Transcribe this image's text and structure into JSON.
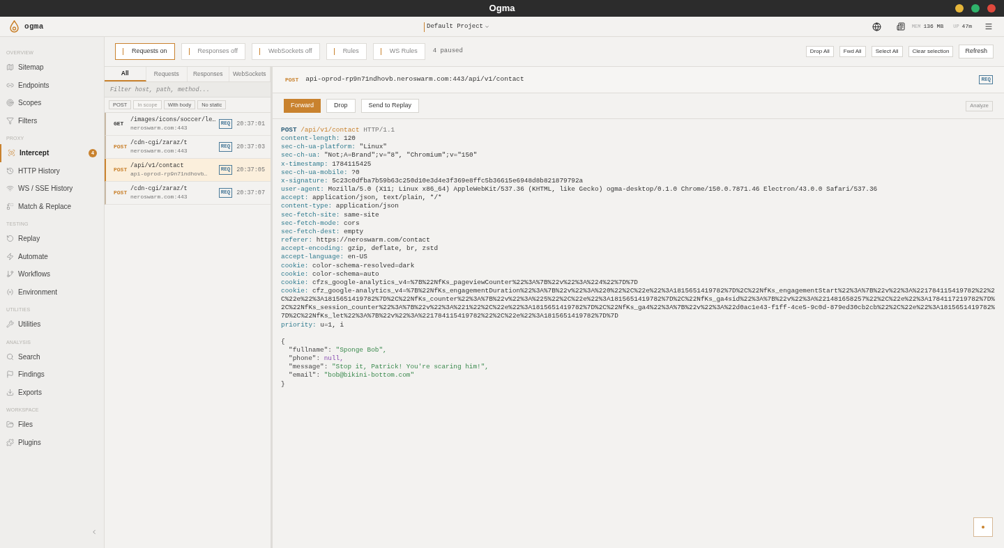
{
  "window": {
    "title": "Ogma"
  },
  "header": {
    "app_name": "ogma",
    "project": "Default Project",
    "mem_label": "MEM",
    "mem_value": "136 MB",
    "up_label": "UP",
    "up_value": "47m"
  },
  "sidebar": {
    "sections": [
      {
        "title": "OVERVIEW",
        "items": [
          {
            "label": "Sitemap",
            "selected": false
          },
          {
            "label": "Endpoints",
            "selected": false
          },
          {
            "label": "Scopes",
            "selected": false
          },
          {
            "label": "Filters",
            "selected": false
          }
        ]
      },
      {
        "title": "PROXY",
        "items": [
          {
            "label": "Intercept",
            "selected": true,
            "badge": "4"
          },
          {
            "label": "HTTP History",
            "selected": false
          },
          {
            "label": "WS / SSE History",
            "selected": false
          },
          {
            "label": "Match & Replace",
            "selected": false
          }
        ]
      },
      {
        "title": "TESTING",
        "items": [
          {
            "label": "Replay",
            "selected": false
          },
          {
            "label": "Automate",
            "selected": false
          },
          {
            "label": "Workflows",
            "selected": false
          },
          {
            "label": "Environment",
            "selected": false
          }
        ]
      },
      {
        "title": "UTILITIES",
        "items": [
          {
            "label": "Utilities",
            "selected": false
          }
        ]
      },
      {
        "title": "ANALYSIS",
        "items": [
          {
            "label": "Search",
            "selected": false
          },
          {
            "label": "Findings",
            "selected": false
          },
          {
            "label": "Exports",
            "selected": false
          }
        ]
      },
      {
        "title": "WORKSPACE",
        "items": [
          {
            "label": "Files",
            "selected": false
          },
          {
            "label": "Plugins",
            "selected": false
          }
        ]
      }
    ]
  },
  "toolbar": {
    "toggles": [
      {
        "label": "Requests on",
        "active": true
      },
      {
        "label": "Responses off",
        "active": false
      },
      {
        "label": "WebSockets off",
        "active": false
      },
      {
        "label": "Rules",
        "active": false
      },
      {
        "label": "WS Rules",
        "active": false
      }
    ],
    "paused": "4 paused",
    "actions": [
      "Drop All",
      "Fwd All",
      "Select All",
      "Clear selection"
    ],
    "refresh": "Refresh"
  },
  "flows": {
    "tabs": [
      {
        "label": "All",
        "selected": true
      },
      {
        "label": "Requests",
        "selected": false
      },
      {
        "label": "Responses",
        "selected": false
      },
      {
        "label": "WebSockets",
        "selected": false
      }
    ],
    "filter_placeholder": "Filter host, path, method...",
    "chips": [
      {
        "label": "POST",
        "disabled": false
      },
      {
        "label": "In scope",
        "disabled": true
      },
      {
        "label": "With body",
        "disabled": false
      },
      {
        "label": "No static",
        "disabled": false
      }
    ],
    "rows": [
      {
        "method": "GET",
        "color": "#333333",
        "path": "/images/icons/soccer/le…",
        "host": "neroswarm.com:443",
        "badge": "REQ",
        "time": "20:37:01",
        "selected": false
      },
      {
        "method": "POST",
        "color": "#c9822e",
        "path": "/cdn-cgi/zaraz/t",
        "host": "neroswarm.com:443",
        "badge": "REQ",
        "time": "20:37:03",
        "selected": false
      },
      {
        "method": "POST",
        "color": "#c9822e",
        "path": "/api/v1/contact",
        "host": "api-oprod-rp9n71ndhovb…",
        "badge": "REQ",
        "time": "20:37:05",
        "selected": true
      },
      {
        "method": "POST",
        "color": "#c9822e",
        "path": "/cdn-cgi/zaraz/t",
        "host": "neroswarm.com:443",
        "badge": "REQ",
        "time": "20:37:07",
        "selected": false
      }
    ]
  },
  "detail": {
    "method": "POST",
    "url": "api-oprod-rp9n71ndhovb.neroswarm.com:443/api/v1/contact",
    "badge": "REQ",
    "buttons": [
      {
        "label": "Forward",
        "kind": "primary"
      },
      {
        "label": "Drop",
        "kind": "plain"
      },
      {
        "label": "Send to Replay",
        "kind": "plain"
      }
    ],
    "analyze": "Analyze",
    "request_line": {
      "method": "POST",
      "path": "/api/v1/contact",
      "version": "HTTP/1.1"
    },
    "headers": [
      {
        "name": "content-length:",
        "value": "120"
      },
      {
        "name": "sec-ch-ua-platform:",
        "value": "\"Linux\""
      },
      {
        "name": "sec-ch-ua:",
        "value": "\"Not;A=Brand\";v=\"8\", \"Chromium\";v=\"150\""
      },
      {
        "name": "x-timestamp:",
        "value": "1784115425"
      },
      {
        "name": "sec-ch-ua-mobile:",
        "value": "?0"
      },
      {
        "name": "x-signature:",
        "value": "5c23c0dfba7b59b63c250d10e3d4e3f369e8ffc5b36615e6948d8b821879792a"
      },
      {
        "name": "user-agent:",
        "value": "Mozilla/5.0 (X11; Linux x86_64) AppleWebKit/537.36 (KHTML, like Gecko) ogma-desktop/0.1.0 Chrome/150.0.7871.46 Electron/43.0.0 Safari/537.36"
      },
      {
        "name": "accept:",
        "value": "application/json, text/plain, */*"
      },
      {
        "name": "content-type:",
        "value": "application/json"
      },
      {
        "name": "sec-fetch-site:",
        "value": "same-site"
      },
      {
        "name": "sec-fetch-mode:",
        "value": "cors"
      },
      {
        "name": "sec-fetch-dest:",
        "value": "empty"
      },
      {
        "name": "referer:",
        "value": "https://neroswarm.com/contact"
      },
      {
        "name": "accept-encoding:",
        "value": "gzip, deflate, br, zstd"
      },
      {
        "name": "accept-language:",
        "value": "en-US"
      },
      {
        "name": "cookie:",
        "value": "color-schema-resolved=dark"
      },
      {
        "name": "cookie:",
        "value": "color-schema=auto"
      },
      {
        "name": "cookie:",
        "value": "cfzs_google-analytics_v4=%7B%22NfKs_pageviewCounter%22%3A%7B%22v%22%3A%224%22%7D%7D"
      },
      {
        "name": "cookie:",
        "value": "cfz_google-analytics_v4=%7B%22NfKs_engagementDuration%22%3A%7B%22v%22%3A%220%22%2C%22e%22%3A1815651419782%7D%2C%22NfKs_engagementStart%22%3A%7B%22v%22%3A%221784115419782%22%2C%22e%22%3A1815651419782%7D%2C%22NfKs_counter%22%3A%7B%22v%22%3A%225%22%2C%22e%22%3A1815651419782%7D%2C%22NfKs_ga4sid%22%3A%7B%22v%22%3A%221481658257%22%2C%22e%22%3A1784117219782%7D%2C%22NfKs_session_counter%22%3A%7B%22v%22%3A%221%22%2C%22e%22%3A1815651419782%7D%2C%22NfKs_ga4%22%3A%7B%22v%22%3A%22d0ac1e43-f1ff-4ce5-9c0d-879ed30cb2cb%22%2C%22e%22%3A1815651419782%7D%2C%22NfKs_let%22%3A%7B%22v%22%3A%221784115419782%22%2C%22e%22%3A1815651419782%7D%7D"
      },
      {
        "name": "priority:",
        "value": "u=1, i"
      }
    ],
    "body": [
      {
        "kind": "brace",
        "text": "{"
      },
      {
        "kind": "string",
        "key": "\"fullname\":",
        "value": "\"Sponge Bob\","
      },
      {
        "kind": "null",
        "key": "\"phone\":",
        "value": "null,"
      },
      {
        "kind": "string",
        "key": "\"message\":",
        "value": "\"Stop it, Patrick! You're scaring him!\","
      },
      {
        "kind": "string",
        "key": "\"email\":",
        "value": "\"bob@bikini-bottom.com\""
      },
      {
        "kind": "brace",
        "text": "}"
      }
    ]
  }
}
